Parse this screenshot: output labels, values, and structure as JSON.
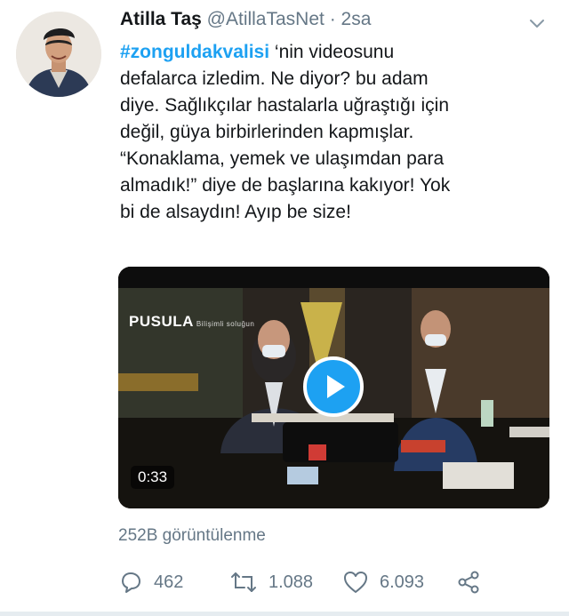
{
  "tweet": {
    "author_name": "Atilla Taş",
    "handle": "@AtillaTasNet",
    "separator": "·",
    "time": "2sa",
    "hashtag": "#zonguldakvalisi",
    "text_lines": [
      " ‘nin videosunu",
      "defalarca izledim. Ne diyor? bu adam",
      "diye. Sağlıkçılar hastalarla uğraştığı için",
      "değil, güya birbirlerinden kapmışlar.",
      "“Konaklama, yemek ve ulaşımdan para",
      "almadık!” diye de başlarına kakıyor! Yok",
      "bi de alsaydın! Ayıp be size!"
    ]
  },
  "media": {
    "watermark": "PUSULA",
    "watermark_sub": "Bilişimli soluğun",
    "duration": "0:33",
    "play_icon": "play-icon"
  },
  "stats": {
    "views": "252B görüntülenme",
    "replies": "462",
    "retweets": "1.088",
    "likes": "6.093"
  },
  "colors": {
    "accent": "#1da1f2",
    "muted": "#657786",
    "text": "#14171a"
  },
  "icons": [
    "chevron-down-icon",
    "reply-icon",
    "retweet-icon",
    "like-icon",
    "share-icon"
  ]
}
